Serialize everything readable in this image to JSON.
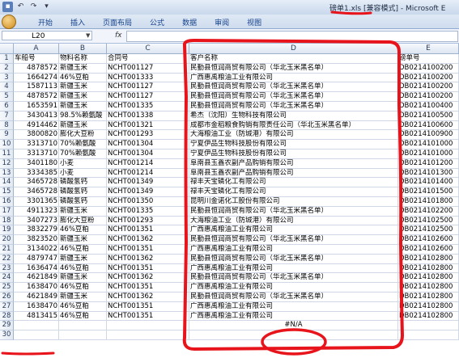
{
  "titlebar": {
    "title": "磅单1.xls  [兼容模式] - Microsoft E"
  },
  "ribbon": {
    "tabs": [
      "开始",
      "插入",
      "页面布局",
      "公式",
      "数据",
      "审阅",
      "视图"
    ]
  },
  "formula_bar": {
    "cell_ref": "L20",
    "fx_label": "fx",
    "value": ""
  },
  "sheet": {
    "columns": [
      "A",
      "B",
      "C",
      "D",
      "E"
    ],
    "rows": [
      [
        "1",
        "车船号",
        "物料名称",
        "合同号",
        "客户名称",
        "磅单号"
      ],
      [
        "2",
        "4878572",
        "新疆玉米",
        "NCHT001127",
        "民勤县恒润商贸有限公司（华北玉米黑名单）",
        "DB0214100200"
      ],
      [
        "3",
        "1664274",
        "46%豆粕",
        "NCHT001333",
        "广西惠禹粮油工业有限公司",
        "DB0214100200"
      ],
      [
        "4",
        "1587113",
        "新疆玉米",
        "NCHT001127",
        "民勤县恒润商贸有限公司（华北玉米黑名单）",
        "DB0214100200"
      ],
      [
        "5",
        "4878572",
        "新疆玉米",
        "NCHT001127",
        "民勤县恒润商贸有限公司（华北玉米黑名单）",
        "DB0214100200"
      ],
      [
        "6",
        "1653591",
        "新疆玉米",
        "NCHT001335",
        "民勤县恒润商贸有限公司（华北玉米黑名单）",
        "DB0214100400"
      ],
      [
        "7",
        "3430413",
        "98.5%赖氨酸",
        "NCHT001338",
        "希杰（沈阳）生物科技有限公司",
        "DB0214100500"
      ],
      [
        "8",
        "4914462",
        "新疆玉米",
        "NCHT001321",
        "成都市金稻粮食购销有限责任公司（华北玉米黑名单）",
        "DB0214100600"
      ],
      [
        "9",
        "3800820",
        "膨化大豆粉",
        "NCHT001293",
        "大海粮油工业（防城港）有限公司",
        "DB0214100900"
      ],
      [
        "10",
        "3313710",
        "70%赖氨酸",
        "NCHT001304",
        "宁夏伊品生物科技股份有限公司",
        "DB0214101000"
      ],
      [
        "11",
        "3313710",
        "70%赖氨酸",
        "NCHT001304",
        "宁夏伊品生物科技股份有限公司",
        "DB0214101000"
      ],
      [
        "12",
        "3401180",
        "小麦",
        "NCHT001214",
        "阜南县玉鑫农副产品购销有限公司",
        "DB0214101200"
      ],
      [
        "13",
        "3334385",
        "小麦",
        "NCHT001214",
        "阜南县玉鑫农副产品购销有限公司",
        "DB0214101300"
      ],
      [
        "14",
        "3465728",
        "磷酸氢钙",
        "NCHT001349",
        "禄丰天宝磷化工有限公司",
        "DB0214101400"
      ],
      [
        "15",
        "3465728",
        "磷酸氢钙",
        "NCHT001349",
        "禄丰天宝磷化工有限公司",
        "DB0214101500"
      ],
      [
        "16",
        "3301365",
        "磷酸氢钙",
        "NCHT001350",
        "昆明川金诺化工股份有限公司",
        "DB0214101800"
      ],
      [
        "17",
        "4911323",
        "新疆玉米",
        "NCHT001335",
        "民勤县恒润商贸有限公司（华北玉米黑名单）",
        "DB0214102200"
      ],
      [
        "18",
        "3407273",
        "膨化大豆粉",
        "NCHT001293",
        "大海粮油工业（防城港）有限公司",
        "DB0214102500"
      ],
      [
        "19",
        "3832279",
        "46%豆粕",
        "NCHT001351",
        "广西惠禹粮油工业有限公司",
        "DB0214102500"
      ],
      [
        "20",
        "3823520",
        "新疆玉米",
        "NCHT001362",
        "民勤县恒润商贸有限公司（华北玉米黑名单）",
        "DB0214102600"
      ],
      [
        "21",
        "3134022",
        "46%豆粕",
        "NCHT001351",
        "广西惠禹粮油工业有限公司",
        "DB0214102600"
      ],
      [
        "22",
        "4879747",
        "新疆玉米",
        "NCHT001362",
        "民勤县恒润商贸有限公司（华北玉米黑名单）",
        "DB0214102800"
      ],
      [
        "23",
        "1636474",
        "46%豆粕",
        "NCHT001351",
        "广西惠禹粮油工业有限公司",
        "DB0214102800"
      ],
      [
        "24",
        "4621849",
        "新疆玉米",
        "NCHT001362",
        "民勤县恒润商贸有限公司（华北玉米黑名单）",
        "DB0214102800"
      ],
      [
        "25",
        "1638470",
        "46%豆粕",
        "NCHT001351",
        "广西惠禹粮油工业有限公司",
        "DB0214102800"
      ],
      [
        "26",
        "4621849",
        "新疆玉米",
        "NCHT001362",
        "民勤县恒润商贸有限公司（华北玉米黑名单）",
        "DB0214102800"
      ],
      [
        "27",
        "1638470",
        "46%豆粕",
        "NCHT001351",
        "广西惠禹粮油工业有限公司",
        "DB0214102800"
      ],
      [
        "28",
        "4813415",
        "46%豆粕",
        "NCHT001351",
        "广西惠禹粮油工业有限公司",
        "DB0214102800"
      ],
      [
        "29",
        "",
        "",
        "",
        "#N/A",
        ""
      ],
      [
        "30",
        "",
        "",
        "",
        "",
        ""
      ]
    ]
  },
  "colors": {
    "annotation": "#e8141c",
    "ribbon_text": "#15428b"
  }
}
